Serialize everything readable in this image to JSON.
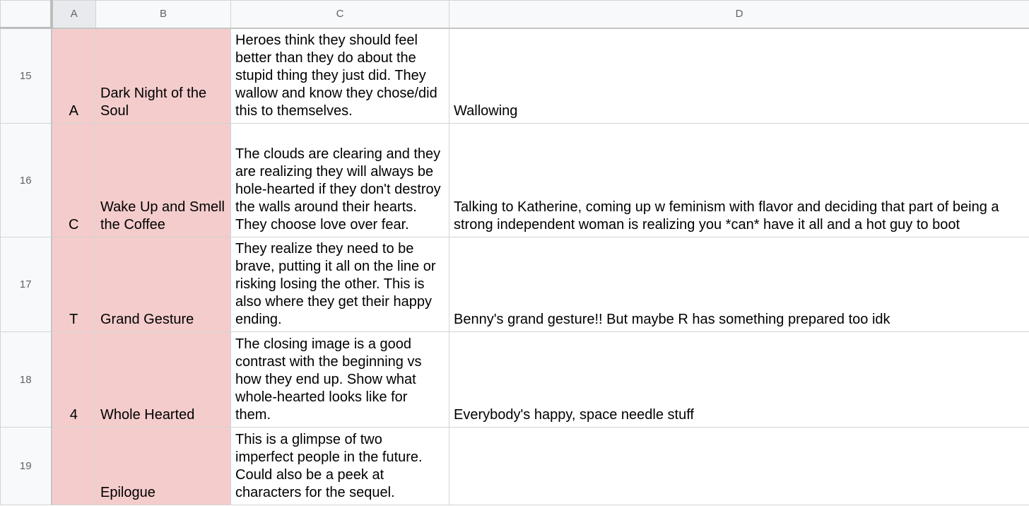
{
  "columns": {
    "a": "A",
    "b": "B",
    "c": "C",
    "d": "D"
  },
  "rows": [
    {
      "num": "15",
      "a": "A",
      "b": "Dark Night of the Soul",
      "c": "Heroes think they should feel better than they do about the stupid thing they just did. They wallow and know they chose/did this to themselves.",
      "d": "Wallowing"
    },
    {
      "num": "16",
      "a": "C",
      "b": "Wake Up and Smell the Coffee",
      "c": "The clouds are clearing and they are realizing they will always be hole-hearted if they don't destroy the walls around their hearts. They choose love over fear.",
      "d": "Talking to Katherine, coming up w feminism with flavor and deciding that part of being a strong independent woman is realizing you *can* have it all and a hot guy to boot"
    },
    {
      "num": "17",
      "a": "T",
      "b": "Grand Gesture",
      "c": "They realize they need to be brave, putting it all on the line or risking losing the other. This is also where they get their happy ending.",
      "d": "Benny's grand gesture!! But maybe R has something prepared too idk"
    },
    {
      "num": "18",
      "a": "4",
      "b": "Whole Hearted",
      "c": "The closing image is a good contrast with the beginning vs how they end up. Show what whole-hearted looks like for them.",
      "d": "Everybody's happy, space needle stuff"
    },
    {
      "num": "19",
      "a": "",
      "b": "Epilogue",
      "c": "This is a glimpse of two imperfect people in the future. Could also be a peek at characters for the sequel.",
      "d": ""
    }
  ],
  "colors": {
    "pink_fill": "#f4cccc",
    "header_bg": "#f8f9fa",
    "selected_header_bg": "#e8eaed",
    "grid_line": "#d4d4d4"
  }
}
